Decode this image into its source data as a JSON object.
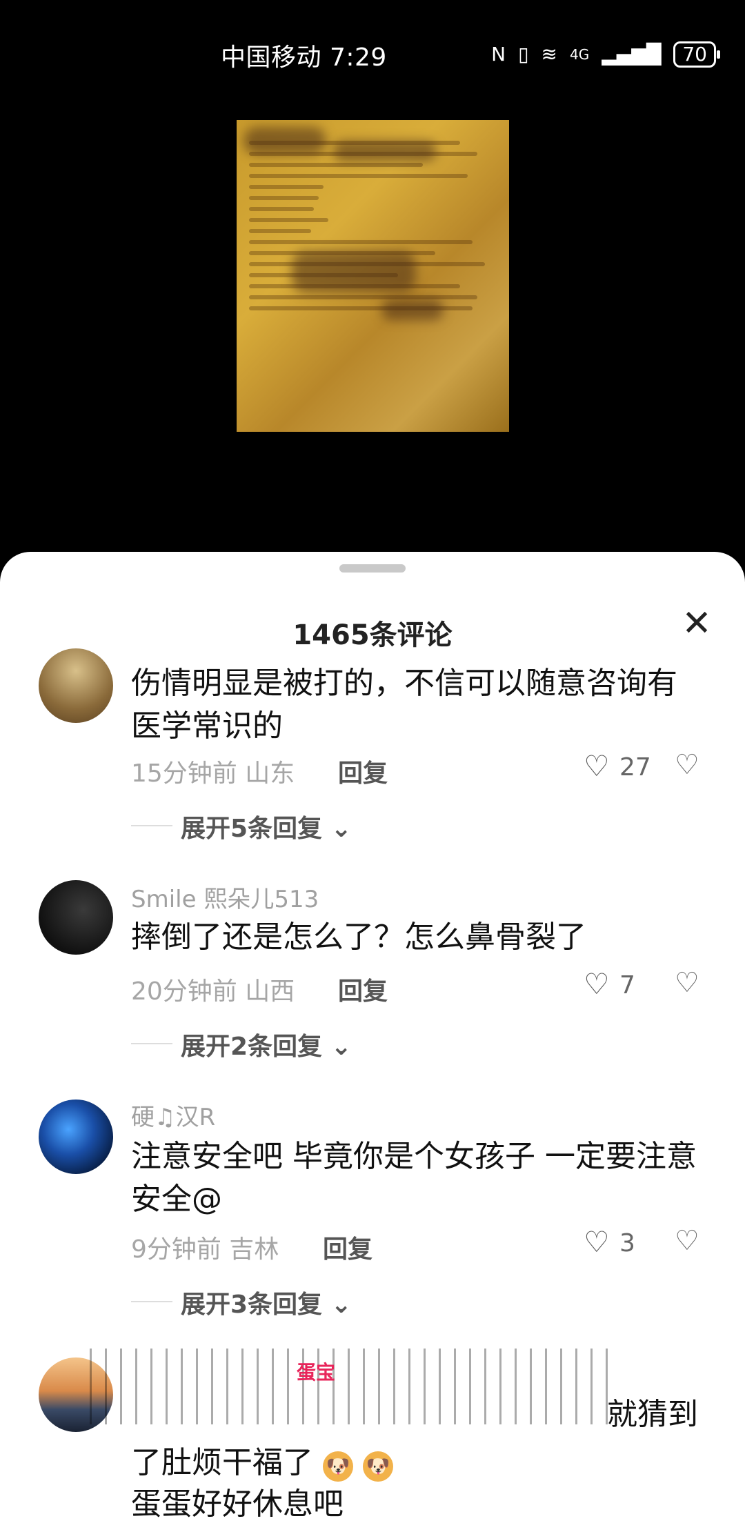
{
  "status_bar": {
    "carrier_time": "中国移动 7:29",
    "nfc": "N",
    "vibrate": "▯",
    "wifi": "≋",
    "network": "4G",
    "signal": "▂▄▆█",
    "battery": "70"
  },
  "sheet": {
    "title": "1465条评论",
    "close": "✕"
  },
  "comments": [
    {
      "text": "伤情明显是被打的，不信可以随意咨询有医学常识的",
      "time_location": "15分钟前 山东",
      "reply": "回复",
      "likes": "27",
      "expand": "展开5条回复 ⌄"
    },
    {
      "username": "Smile 熙朵儿513",
      "text": "摔倒了还是怎么了？怎么鼻骨裂了",
      "time_location": "20分钟前 山西",
      "reply": "回复",
      "likes": "7",
      "expand": "展开2条回复 ⌄"
    },
    {
      "username": "硬♫汉R",
      "text": "注意安全吧 毕竟你是个女孩子 一定要注意安全@",
      "time_location": "9分钟前 吉林",
      "reply": "回复",
      "likes": "3",
      "expand": "展开3条回复 ⌄"
    },
    {
      "tag": "蛋宝",
      "text_right": "就猜到",
      "text_line2": "了肚烦干福了",
      "text_line3": "蛋蛋好好休息吧"
    }
  ],
  "icons": {
    "like": "♡",
    "dislike": "♡"
  }
}
